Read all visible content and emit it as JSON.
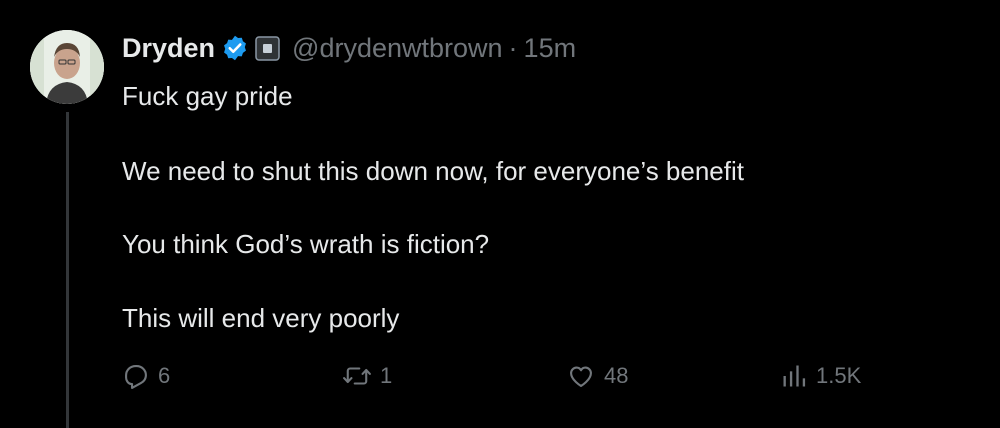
{
  "author": {
    "display_name": "Dryden",
    "handle": "@drydenwtbrown",
    "separator": "·",
    "time": "15m"
  },
  "tweet": {
    "paragraphs": [
      "Fuck gay pride",
      "We need to shut this down now, for everyone’s benefit",
      "You think God’s wrath is fiction?",
      "This will end very poorly"
    ]
  },
  "actions": {
    "replies": "6",
    "reposts": "1",
    "likes": "48",
    "views": "1.5K"
  },
  "colors": {
    "background": "#000000",
    "text": "#e7e9ea",
    "muted": "#71767b",
    "verified": "#1d9bf0"
  },
  "icons": [
    "verified-badge-icon",
    "affiliation-badge-icon",
    "reply-icon",
    "repost-icon",
    "like-icon",
    "views-icon"
  ]
}
